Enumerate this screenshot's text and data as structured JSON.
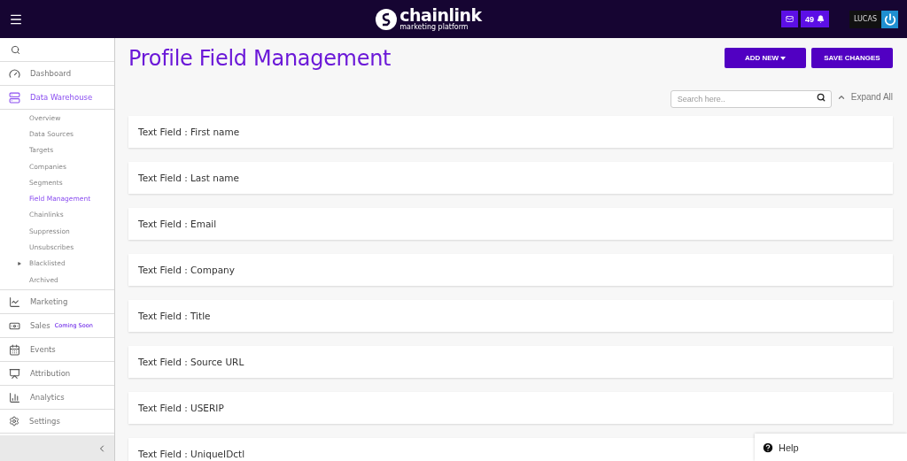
{
  "header": {
    "logo_name": "chainlink",
    "logo_tagline": "marketing platform",
    "notification_count": "49",
    "user": "LUCAS"
  },
  "sidebar": {
    "items": [
      {
        "label": "Dashboard",
        "selected": false
      },
      {
        "label": "Data Warehouse",
        "selected": true,
        "children": [
          {
            "label": "Overview",
            "selected": false
          },
          {
            "label": "Data Sources",
            "selected": false
          },
          {
            "label": "Targets",
            "selected": false
          },
          {
            "label": "Companies",
            "selected": false
          },
          {
            "label": "Segments",
            "selected": false
          },
          {
            "label": "Field Management",
            "selected": true
          },
          {
            "label": "Chainlinks",
            "selected": false
          },
          {
            "label": "Suppression",
            "selected": false
          },
          {
            "label": "Unsubscribes",
            "selected": false
          },
          {
            "label": "Blacklisted",
            "selected": false,
            "expandable": true
          },
          {
            "label": "Archived",
            "selected": false
          }
        ]
      },
      {
        "label": "Marketing",
        "selected": false
      },
      {
        "label": "Sales",
        "selected": false,
        "badge": "Coming Soon"
      },
      {
        "label": "Events",
        "selected": false
      },
      {
        "label": "Attribution",
        "selected": false
      },
      {
        "label": "Analytics",
        "selected": false
      }
    ],
    "settings": "Settings"
  },
  "page": {
    "title": "Profile Field Management",
    "buttons": [
      {
        "label": "ADD NEW",
        "dropdown": true
      },
      {
        "label": "SAVE CHANGES",
        "dropdown": false
      }
    ],
    "search": {
      "placeholder": "Search here.."
    },
    "expand_all": "Expand All",
    "fields": [
      "Text Field : First name",
      "Text Field : Last name",
      "Text Field : Email",
      "Text Field : Company",
      "Text Field : Title",
      "Text Field : Source URL",
      "Text Field : USERIP",
      "Text Field : UniqueIDctl"
    ]
  },
  "help": "Help"
}
